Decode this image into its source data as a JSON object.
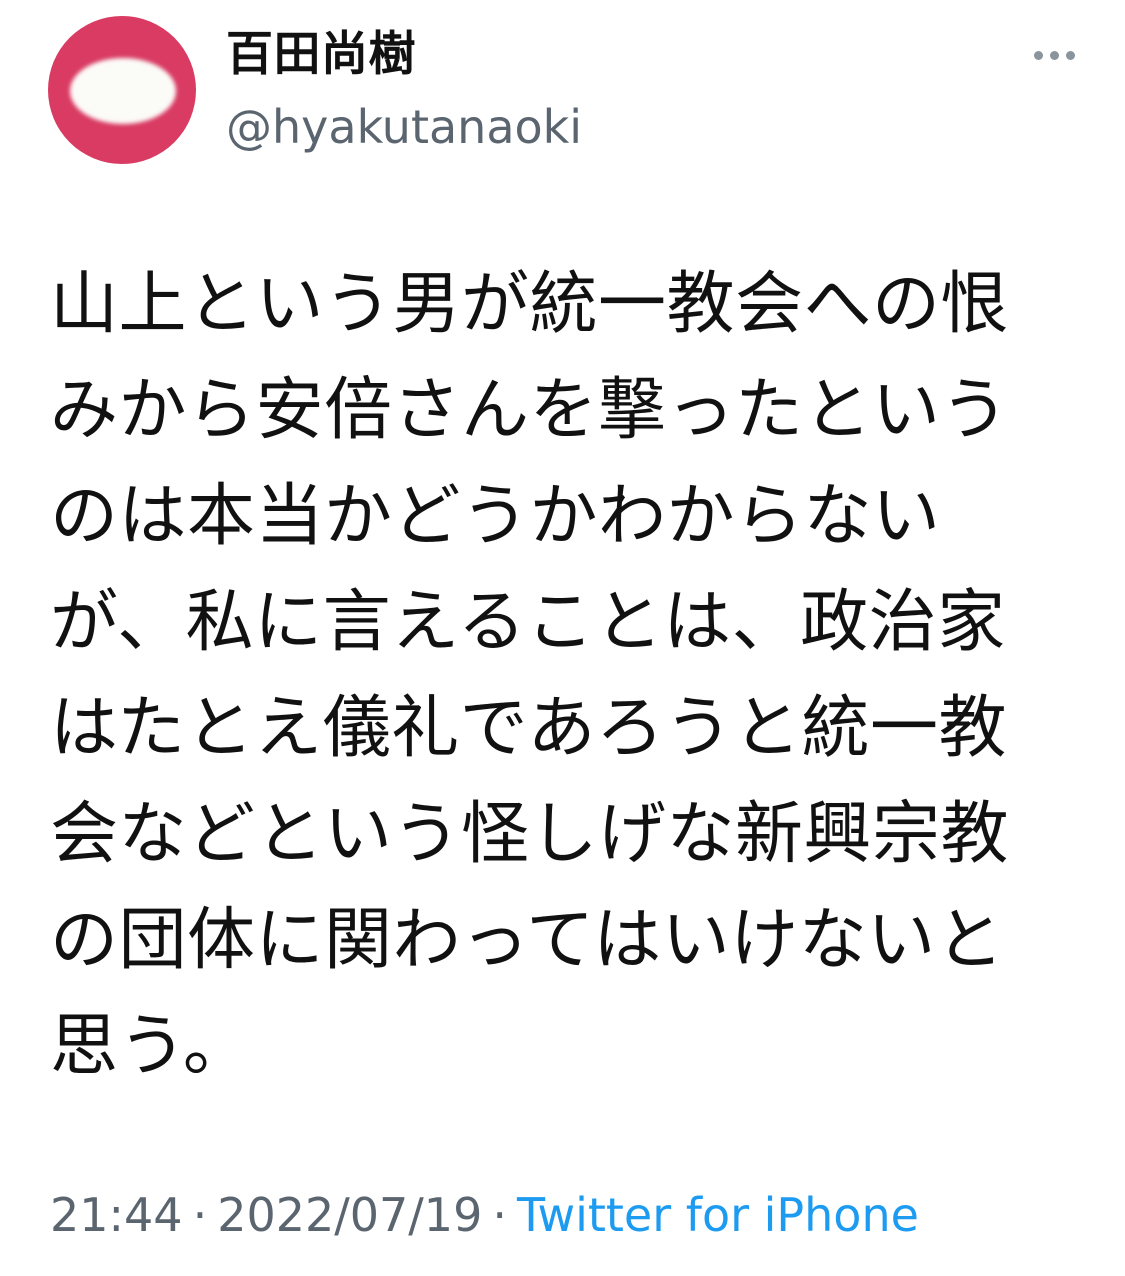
{
  "author": {
    "display_name": "百田尚樹",
    "handle": "@hyakutanaoki",
    "avatar_icon": "avatar-image",
    "avatar_color": "#d93b63"
  },
  "more_icon": "more-horizontal-icon",
  "tweet": {
    "lines": [
      "山上という男が統一教会への恨",
      "みから安倍さんを撃ったという",
      "のは本当かどうかわからない",
      "が、私に言えることは、政治家",
      "はたとえ儀礼であろうと統一教",
      "会などという怪しげな新興宗教",
      "の団体に関わってはいけないと",
      "思う。"
    ]
  },
  "meta": {
    "time": "21:44",
    "separator": "·",
    "date": "2022/07/19",
    "source": "Twitter for iPhone",
    "source_color": "#1d9bf0"
  }
}
